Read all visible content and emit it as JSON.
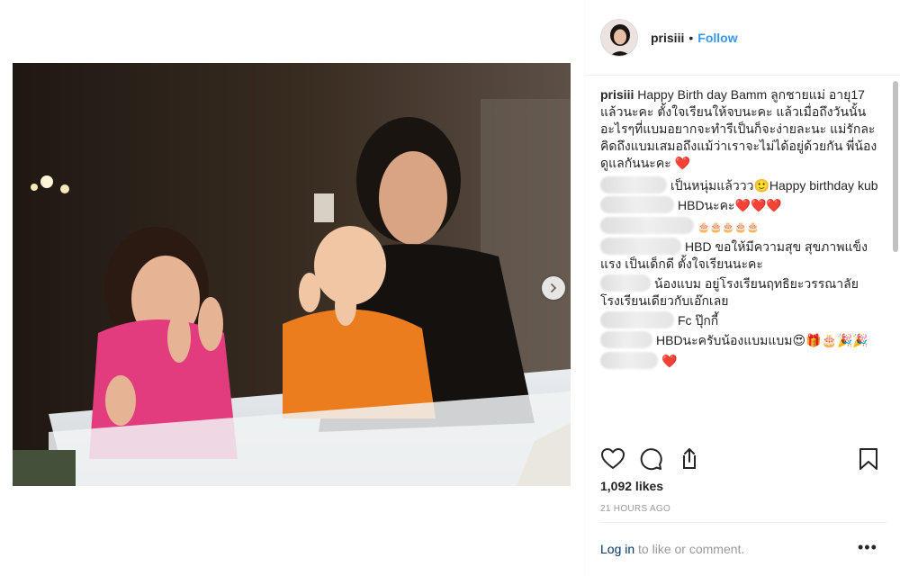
{
  "header": {
    "username": "prisiii",
    "separator": "•",
    "follow_label": "Follow"
  },
  "caption": {
    "username": "prisiii",
    "text": "Happy Birth day Bamm ลูกชายแม่ อายุ17 แล้วนะคะ ตั้งใจเรียนให้จบนะคะ แล้วเมื่อถึงวันนั้นอะไรๆที่แบมอยากจะทำรีเป็นก็จะง่ายละนะ แม่รักละคิดถึงแบมเสมอถึงแม้ว่าเราจะไม่ได้อยู่ด้วยกัน พี่น้องดูแลกันนะคะ",
    "heart": "❤️"
  },
  "comments": [
    {
      "text": "เป็นหนุ่มแล้ววว🙂Happy birthday kub",
      "emoji": ""
    },
    {
      "text": "HBDนะคะ",
      "emoji": "❤️❤️❤️"
    },
    {
      "text": "",
      "emoji": "🎂🎂🎂🎂🎂"
    },
    {
      "text": "HBD ขอให้มีความสุข สุขภาพแข็งแรง เป็นเด็กดี ตั้งใจเรียนนะคะ",
      "emoji": ""
    },
    {
      "text": "น้องแบม อยู่โรงเรียนฤทธิยะวรรณาลัย โรงเรียนเดียวกับเอ๊กเลย",
      "emoji": ""
    },
    {
      "text": "Fc ปุ๊กกี้",
      "emoji": ""
    },
    {
      "text": "HBDนะครับน้องแบมแบม",
      "emoji": "😍🎁🎂🎉🎉"
    },
    {
      "text": "",
      "emoji": "❤️"
    }
  ],
  "actions": {
    "like_icon": "heart-outline-icon",
    "comment_icon": "comment-bubble-icon",
    "share_icon": "share-icon",
    "save_icon": "bookmark-icon"
  },
  "likes": "1,092 likes",
  "timestamp": "21 HOURS AGO",
  "login": {
    "link": "Log in",
    "rest": " to like or comment.",
    "more_label": "•••"
  },
  "colors": {
    "accent": "#3897f0",
    "link_dark": "#003569",
    "text": "#262626",
    "muted": "#999999",
    "heart": "#ed1c2e"
  }
}
